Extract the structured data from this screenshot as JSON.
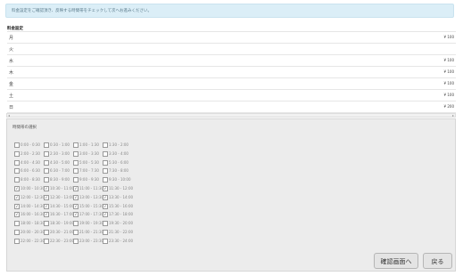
{
  "notice": "料金設定をご確認頂き、反映する時間帯をチェックして次へお進みください。",
  "price_section_title": "料金設定",
  "prices": [
    {
      "day": "月",
      "price": "¥ 100"
    },
    {
      "day": "火",
      "price": ""
    },
    {
      "day": "水",
      "price": "¥ 100"
    },
    {
      "day": "木",
      "price": "¥ 100"
    },
    {
      "day": "金",
      "price": "¥ 100"
    },
    {
      "day": "土",
      "price": "¥ 100"
    },
    {
      "day": "日",
      "price": "¥ 200"
    }
  ],
  "scroll": {
    "left_arrow": "◂",
    "right_arrow": "▸"
  },
  "slots_title": "時間帯の選択",
  "slot_rows": [
    [
      {
        "label": "0:00 - 0:30",
        "checked": false
      },
      {
        "label": "0:30 - 1:00",
        "checked": false
      },
      {
        "label": "1:00 - 1:30",
        "checked": false
      },
      {
        "label": "1:30 - 2:00",
        "checked": false
      }
    ],
    [
      {
        "label": "2:00 - 2:30",
        "checked": false
      },
      {
        "label": "2:30 - 3:00",
        "checked": false
      },
      {
        "label": "3:00 - 3:30",
        "checked": false
      },
      {
        "label": "3:30 - 4:00",
        "checked": false
      }
    ],
    [
      {
        "label": "4:00 - 4:30",
        "checked": false
      },
      {
        "label": "4:30 - 5:00",
        "checked": false
      },
      {
        "label": "5:00 - 5:30",
        "checked": false
      },
      {
        "label": "5:30 - 6:00",
        "checked": false
      }
    ],
    [
      {
        "label": "6:00 - 6:30",
        "checked": false
      },
      {
        "label": "6:30 - 7:00",
        "checked": false
      },
      {
        "label": "7:00 - 7:30",
        "checked": false
      },
      {
        "label": "7:30 - 8:00",
        "checked": false
      }
    ],
    [
      {
        "label": "8:00 - 8:30",
        "checked": false
      },
      {
        "label": "8:30 - 9:00",
        "checked": false
      },
      {
        "label": "9:00 - 9:30",
        "checked": false
      },
      {
        "label": "9:30 - 10:00",
        "checked": false
      }
    ],
    [
      {
        "label": "10:00 - 10:30",
        "checked": true
      },
      {
        "label": "10:30 - 11:00",
        "checked": true
      },
      {
        "label": "11:00 - 11:30",
        "checked": true
      },
      {
        "label": "11:30 - 12:00",
        "checked": true
      }
    ],
    [
      {
        "label": "12:00 - 12:30",
        "checked": true
      },
      {
        "label": "12:30 - 13:00",
        "checked": true
      },
      {
        "label": "13:00 - 13:30",
        "checked": true
      },
      {
        "label": "13:30 - 14:00",
        "checked": true
      }
    ],
    [
      {
        "label": "14:00 - 14:30",
        "checked": true
      },
      {
        "label": "14:30 - 15:00",
        "checked": true
      },
      {
        "label": "15:00 - 15:30",
        "checked": true
      },
      {
        "label": "15:30 - 16:00",
        "checked": true
      }
    ],
    [
      {
        "label": "16:00 - 16:30",
        "checked": true
      },
      {
        "label": "16:30 - 17:00",
        "checked": true
      },
      {
        "label": "17:00 - 17:30",
        "checked": true
      },
      {
        "label": "17:30 - 18:00",
        "checked": true
      }
    ],
    [
      {
        "label": "18:00 - 18:30",
        "checked": false
      },
      {
        "label": "18:30 - 19:00",
        "checked": false
      },
      {
        "label": "19:00 - 19:30",
        "checked": false
      },
      {
        "label": "19:30 - 20:00",
        "checked": false
      }
    ],
    [
      {
        "label": "20:00 - 20:30",
        "checked": false
      },
      {
        "label": "20:30 - 21:00",
        "checked": false
      },
      {
        "label": "21:00 - 21:30",
        "checked": false
      },
      {
        "label": "21:30 - 22:00",
        "checked": false
      }
    ],
    [
      {
        "label": "22:00 - 22:30",
        "checked": false
      },
      {
        "label": "22:30 - 23:00",
        "checked": false
      },
      {
        "label": "23:00 - 23:30",
        "checked": false
      },
      {
        "label": "23:30 - 24:00",
        "checked": false
      }
    ]
  ],
  "buttons": {
    "confirm": "確認画面へ",
    "back": "戻る"
  }
}
